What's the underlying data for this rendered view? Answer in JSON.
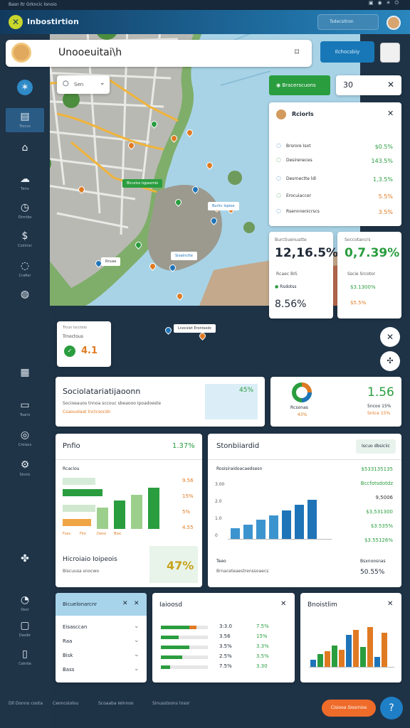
{
  "system_bar": {
    "left": "Basn ltr Grkncic lonoio",
    "right_icons": [
      "lock-icon",
      "wifi-icon",
      "sun-icon",
      "power-icon"
    ]
  },
  "app": {
    "name": "Inbostirtion",
    "logo": "leaf-x-icon"
  },
  "header": {
    "search_text": "Tsdecsitron"
  },
  "topbar": {
    "title": "Unooeuitai\\h",
    "button": "Ilchocsbiy"
  },
  "sidebar": {
    "items": [
      {
        "icon": "compass-icon",
        "label": ""
      },
      {
        "icon": "layout-icon",
        "label": "Trocos"
      },
      {
        "icon": "home-icon",
        "label": ""
      },
      {
        "icon": "cloud-icon",
        "label": "Teiro"
      },
      {
        "icon": "clock-icon",
        "label": "Dtrntbs"
      },
      {
        "icon": "dollar-icon",
        "label": "Coinlrsc"
      },
      {
        "icon": "chat-icon",
        "label": "Crafier"
      },
      {
        "icon": "chart-icon",
        "label": ""
      },
      {
        "icon": "grid-icon",
        "label": ""
      },
      {
        "icon": "monitor-icon",
        "label": "Toaris"
      },
      {
        "icon": "globe-icon",
        "label": "Croiacs"
      },
      {
        "icon": "settings-icon",
        "label": "Sinnic"
      },
      {
        "icon": "share-icon",
        "label": ""
      },
      {
        "icon": "bell-icon",
        "label": "Desr"
      },
      {
        "icon": "folder-icon",
        "label": "Dasibr"
      },
      {
        "icon": "tablet-icon",
        "label": "Ceintie"
      }
    ]
  },
  "map": {
    "search_placeholder": "Sen",
    "chip_green": "Bracerscuons",
    "chip_white": "30",
    "marker_label_1": "Bicuriss Iqpaxmio",
    "marker_label_2": "Burlrc Iopioe",
    "marker_label_3": "Rnuas",
    "marker_label_4": "Sioalnctte",
    "marker_label_5": "Lnocslet Erontsodc",
    "legend_title": "Trcun Iscctoio",
    "legend_sub": "Trnoctous",
    "legend_value": "4.1"
  },
  "panel": {
    "title": "Rciorls",
    "rows": [
      {
        "label": "Brsrore Isot",
        "value": "$0.5%",
        "color": "#2a9d3f"
      },
      {
        "label": "Desireneces",
        "value": "143.5%",
        "color": "#2a9d3f"
      },
      {
        "label": "Desrnectte ldl",
        "value": "1,3.5%",
        "color": "#2a9d3f"
      },
      {
        "label": "Erocuiaccer",
        "value": "5.5%",
        "color": "#e07a22"
      },
      {
        "label": "Rsennnenicrscs",
        "value": "3.5%",
        "color": "#e07a22"
      }
    ]
  },
  "metric_a": {
    "label": "Burctiuenuatte",
    "value": "12,16.5%",
    "sub": "Rcaec BIS",
    "sub2": "Rsdotss",
    "low": "8.56%"
  },
  "metric_b": {
    "label": "Soccotancrs",
    "value": "0,7.39%",
    "sub": "Sscie Srcotor",
    "r1": "$3.1300%",
    "r2": "$5.5%"
  },
  "wide_card": {
    "title": "Sociolatariatijaoonn",
    "desc": "Socioeauos tnnoa sccouc sbeaooo Ipoadoeste",
    "desc2": "Csaouolaat lnctcsocdn",
    "value": "45%"
  },
  "donut_card": {
    "value": "1.56",
    "label": "Rcsonas",
    "sub": "43%",
    "sub2": "5ncoo 15%",
    "sub3": "Sntce 15%"
  },
  "bars_card": {
    "title": "Pnfio",
    "value": "1.37%",
    "legend": "Rcaciou",
    "values_right": [
      "9.56",
      "15%",
      "5%",
      "4.55"
    ],
    "x_labels": [
      "Fuss",
      "Firo",
      "Dano",
      "Bioc"
    ],
    "bars": [
      30,
      40,
      48,
      58
    ],
    "bottom_title": "Hicroiaio Ioipeois",
    "bottom_sub": "Biscuusa snocwo",
    "bottom_value": "47%"
  },
  "line_card": {
    "title": "Stonbiiardid",
    "button": "Iscuo dbsiciic",
    "legend": "Rosisiraidoacaedsesn",
    "y_ticks": [
      "3.00",
      "2.0",
      "1.0",
      "0"
    ],
    "bars": [
      15,
      20,
      27,
      33,
      40,
      48,
      55
    ],
    "right_values": [
      "$533135135",
      "Bccfotsdotdz",
      "9,5006",
      "$3,531300",
      "$3.535%",
      "$3.55126%"
    ],
    "bottom_label": "Teeo",
    "bottom_sub": "Brnaceteaestrenssoaecs",
    "bottom_value": "50.55%",
    "bottom_badge": "Bsxnoosnas"
  },
  "list_card": {
    "title": "Bicuelonarcnr",
    "items": [
      "Eisasccan",
      "Raa",
      "Bisk",
      "Bass"
    ]
  },
  "progress_card": {
    "title": "Iaioosd",
    "rows": [
      {
        "a": "3:3.0",
        "b": "7.5%",
        "fill": 0.76
      },
      {
        "a": "3.56",
        "b": "15%",
        "fill": 0.38
      },
      {
        "a": "3.5%",
        "b": "3.3%",
        "fill": 0.6
      },
      {
        "a": "2.5%",
        "b": "3.5%",
        "fill": 0.45
      },
      {
        "a": "7.5%",
        "b": "3.30",
        "fill": 0.2
      }
    ]
  },
  "hist_card": {
    "title": "Bnoistlim",
    "bars": [
      {
        "v": 10,
        "c": "#1f74b8"
      },
      {
        "v": 18,
        "c": "#2a9d3f"
      },
      {
        "v": 22,
        "c": "#e07a22"
      },
      {
        "v": 30,
        "c": "#2a9d3f"
      },
      {
        "v": 24,
        "c": "#e07a22"
      },
      {
        "v": 45,
        "c": "#1f74b8"
      },
      {
        "v": 52,
        "c": "#e07a22"
      },
      {
        "v": 28,
        "c": "#2a9d3f"
      },
      {
        "v": 56,
        "c": "#e07a22"
      },
      {
        "v": 14,
        "c": "#1f74b8"
      },
      {
        "v": 48,
        "c": "#e07a22"
      }
    ]
  },
  "bottom_bar": {
    "items": [
      "Dll Donno coota",
      "Ceoncsiolou",
      "Scoaaba Ielnnoo",
      "Sinusstoons lnsor"
    ],
    "button": "Cisiooa Siosrnios"
  }
}
